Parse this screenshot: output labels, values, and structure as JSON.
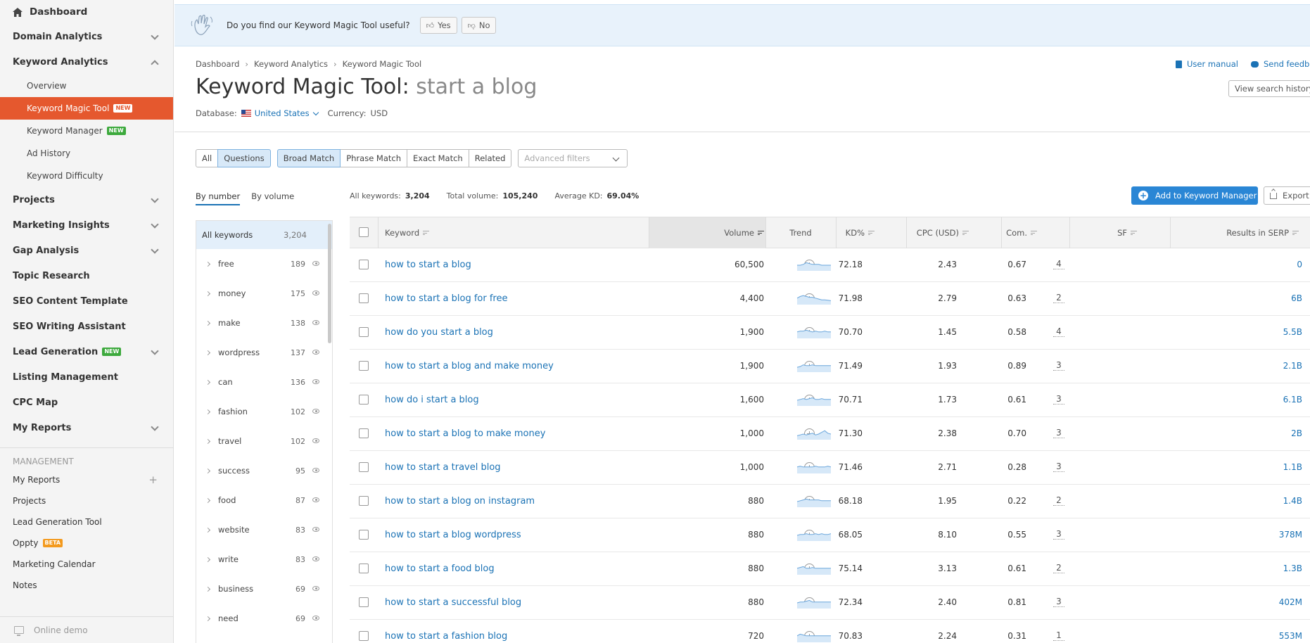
{
  "sidebar": {
    "dashboard": "Dashboard",
    "items": [
      {
        "label": "Domain Analytics",
        "chevron": "down"
      },
      {
        "label": "Keyword Analytics",
        "chevron": "up"
      }
    ],
    "keyword_subitems": [
      {
        "label": "Overview",
        "badge": ""
      },
      {
        "label": "Keyword Magic Tool",
        "badge": "NEW",
        "active": true
      },
      {
        "label": "Keyword Manager",
        "badge": "NEW"
      },
      {
        "label": "Ad History",
        "badge": ""
      },
      {
        "label": "Keyword Difficulty",
        "badge": ""
      }
    ],
    "items2": [
      {
        "label": "Projects",
        "chevron": "down",
        "badge": ""
      },
      {
        "label": "Marketing Insights",
        "chevron": "down",
        "badge": ""
      },
      {
        "label": "Gap Analysis",
        "chevron": "down",
        "badge": ""
      },
      {
        "label": "Topic Research",
        "chevron": "",
        "badge": ""
      },
      {
        "label": "SEO Content Template",
        "chevron": "",
        "badge": ""
      },
      {
        "label": "SEO Writing Assistant",
        "chevron": "",
        "badge": ""
      },
      {
        "label": "Lead Generation",
        "chevron": "down",
        "badge": "NEW"
      },
      {
        "label": "Listing Management",
        "chevron": "",
        "badge": ""
      },
      {
        "label": "CPC Map",
        "chevron": "",
        "badge": ""
      },
      {
        "label": "My Reports",
        "chevron": "down",
        "badge": ""
      }
    ],
    "management_title": "MANAGEMENT",
    "management": [
      {
        "label": "My Reports",
        "plus": true
      },
      {
        "label": "Projects"
      },
      {
        "label": "Lead Generation Tool"
      },
      {
        "label": "Oppty",
        "badge": "BETA"
      },
      {
        "label": "Marketing Calendar"
      },
      {
        "label": "Notes"
      }
    ],
    "online_demo": "Online demo"
  },
  "banner": {
    "question": "Do you find our Keyword Magic Tool useful?",
    "yes": "Yes",
    "no": "No"
  },
  "breadcrumb": [
    "Dashboard",
    "Keyword Analytics",
    "Keyword Magic Tool"
  ],
  "header": {
    "user_manual": "User manual",
    "send_feedback": "Send feedback",
    "view_history": "View search history",
    "title_prefix": "Keyword Magic Tool:",
    "title_query": "start a blog",
    "database_label": "Database:",
    "database_value": "United States",
    "currency_label": "Currency:",
    "currency_value": "USD"
  },
  "filters": {
    "type": [
      "All",
      "Questions"
    ],
    "type_selected": "Questions",
    "match": [
      "Broad Match",
      "Phrase Match",
      "Exact Match",
      "Related"
    ],
    "match_selected": "Broad Match",
    "advanced": "Advanced filters"
  },
  "groups": {
    "tabs": [
      "By number",
      "By volume"
    ],
    "all_label": "All keywords",
    "all_count": "3,204",
    "items": [
      {
        "label": "free",
        "count": "189"
      },
      {
        "label": "money",
        "count": "175"
      },
      {
        "label": "make",
        "count": "138"
      },
      {
        "label": "wordpress",
        "count": "137"
      },
      {
        "label": "can",
        "count": "136"
      },
      {
        "label": "fashion",
        "count": "102"
      },
      {
        "label": "travel",
        "count": "102"
      },
      {
        "label": "success",
        "count": "95"
      },
      {
        "label": "food",
        "count": "87"
      },
      {
        "label": "website",
        "count": "83"
      },
      {
        "label": "write",
        "count": "83"
      },
      {
        "label": "business",
        "count": "69"
      },
      {
        "label": "need",
        "count": "69"
      }
    ]
  },
  "stats": {
    "all_label": "All keywords:",
    "all_value": "3,204",
    "volume_label": "Total volume:",
    "volume_value": "105,240",
    "kd_label": "Average KD:",
    "kd_value": "69.04%"
  },
  "actions": {
    "add": "Add to Keyword Manager",
    "export": "Export"
  },
  "table": {
    "columns": {
      "keyword": "Keyword",
      "volume": "Volume",
      "trend": "Trend",
      "kd": "KD%",
      "cpc": "CPC (USD)",
      "com": "Com.",
      "sf": "SF",
      "results": "Results in SERP"
    },
    "rows": [
      {
        "keyword": "how to start a blog",
        "volume": "60,500",
        "kd": "72.18",
        "cpc": "2.43",
        "com": "0.67",
        "sf": "4",
        "results": "0",
        "trend": [
          0.5,
          0.5,
          0.6,
          0.8,
          0.7,
          0.6,
          0.6,
          0.6,
          0.5,
          0.5,
          0.5,
          0.5
        ]
      },
      {
        "keyword": "how to start a blog for free",
        "volume": "4,400",
        "kd": "71.98",
        "cpc": "2.79",
        "com": "0.63",
        "sf": "2",
        "results": "6B",
        "trend": [
          0.6,
          0.8,
          0.9,
          0.8,
          0.7,
          0.7,
          0.6,
          0.5,
          0.4,
          0.4,
          0.35,
          0.3
        ]
      },
      {
        "keyword": "how do you start a blog",
        "volume": "1,900",
        "kd": "70.70",
        "cpc": "1.45",
        "com": "0.58",
        "sf": "4",
        "results": "5.5B",
        "trend": [
          0.6,
          0.7,
          0.7,
          0.8,
          0.7,
          0.6,
          0.7,
          0.6,
          0.6,
          0.7,
          0.6,
          0.6
        ]
      },
      {
        "keyword": "how to start a blog and make money",
        "volume": "1,900",
        "kd": "71.49",
        "cpc": "1.93",
        "com": "0.89",
        "sf": "3",
        "results": "2.1B",
        "trend": [
          0.4,
          0.5,
          0.7,
          0.6,
          0.6,
          0.7,
          0.6,
          0.6,
          0.6,
          0.6,
          0.6,
          0.6
        ]
      },
      {
        "keyword": "how do i start a blog",
        "volume": "1,600",
        "kd": "70.71",
        "cpc": "1.73",
        "com": "0.61",
        "sf": "3",
        "results": "6.1B",
        "trend": [
          0.5,
          0.6,
          0.7,
          0.6,
          0.7,
          0.8,
          0.6,
          0.6,
          0.7,
          0.6,
          0.6,
          0.6
        ]
      },
      {
        "keyword": "how to start a blog to make money",
        "volume": "1,000",
        "kd": "71.30",
        "cpc": "2.38",
        "com": "0.70",
        "sf": "3",
        "results": "2B",
        "trend": [
          0.3,
          0.4,
          0.5,
          0.4,
          0.5,
          0.6,
          0.4,
          0.5,
          0.7,
          0.9,
          0.6,
          0.5
        ]
      },
      {
        "keyword": "how to start a travel blog",
        "volume": "1,000",
        "kd": "71.46",
        "cpc": "2.71",
        "com": "0.28",
        "sf": "3",
        "results": "1.1B",
        "trend": [
          0.6,
          0.7,
          0.6,
          0.6,
          0.6,
          0.6,
          0.7,
          0.6,
          0.6,
          0.6,
          0.7,
          0.6
        ]
      },
      {
        "keyword": "how to start a blog on instagram",
        "volume": "880",
        "kd": "68.18",
        "cpc": "1.95",
        "com": "0.22",
        "sf": "2",
        "results": "1.4B",
        "trend": [
          0.5,
          0.6,
          0.7,
          0.8,
          0.7,
          0.7,
          0.7,
          0.7,
          0.6,
          0.6,
          0.6,
          0.6
        ]
      },
      {
        "keyword": "how to start a blog wordpress",
        "volume": "880",
        "kd": "68.05",
        "cpc": "8.10",
        "com": "0.55",
        "sf": "3",
        "results": "378M",
        "trend": [
          0.5,
          0.6,
          0.6,
          0.7,
          0.6,
          0.6,
          0.7,
          0.6,
          0.7,
          0.6,
          0.6,
          0.7
        ]
      },
      {
        "keyword": "how to start a food blog",
        "volume": "880",
        "kd": "75.14",
        "cpc": "3.13",
        "com": "0.61",
        "sf": "2",
        "results": "1.3B",
        "trend": [
          0.6,
          0.7,
          0.8,
          0.6,
          0.6,
          0.7,
          0.6,
          0.6,
          0.6,
          0.6,
          0.6,
          0.6
        ]
      },
      {
        "keyword": "how to start a successful blog",
        "volume": "880",
        "kd": "72.34",
        "cpc": "2.40",
        "com": "0.81",
        "sf": "3",
        "results": "402M",
        "trend": [
          0.5,
          0.6,
          0.6,
          0.7,
          0.8,
          0.6,
          0.6,
          0.6,
          0.6,
          0.6,
          0.6,
          0.6
        ]
      },
      {
        "keyword": "how to start a fashion blog",
        "volume": "720",
        "kd": "70.83",
        "cpc": "2.24",
        "com": "0.31",
        "sf": "1",
        "results": "553M",
        "trend": [
          0.6,
          0.8,
          0.7,
          0.6,
          0.6,
          0.6,
          0.6,
          0.6,
          0.6,
          0.6,
          0.6,
          0.6
        ]
      }
    ]
  }
}
